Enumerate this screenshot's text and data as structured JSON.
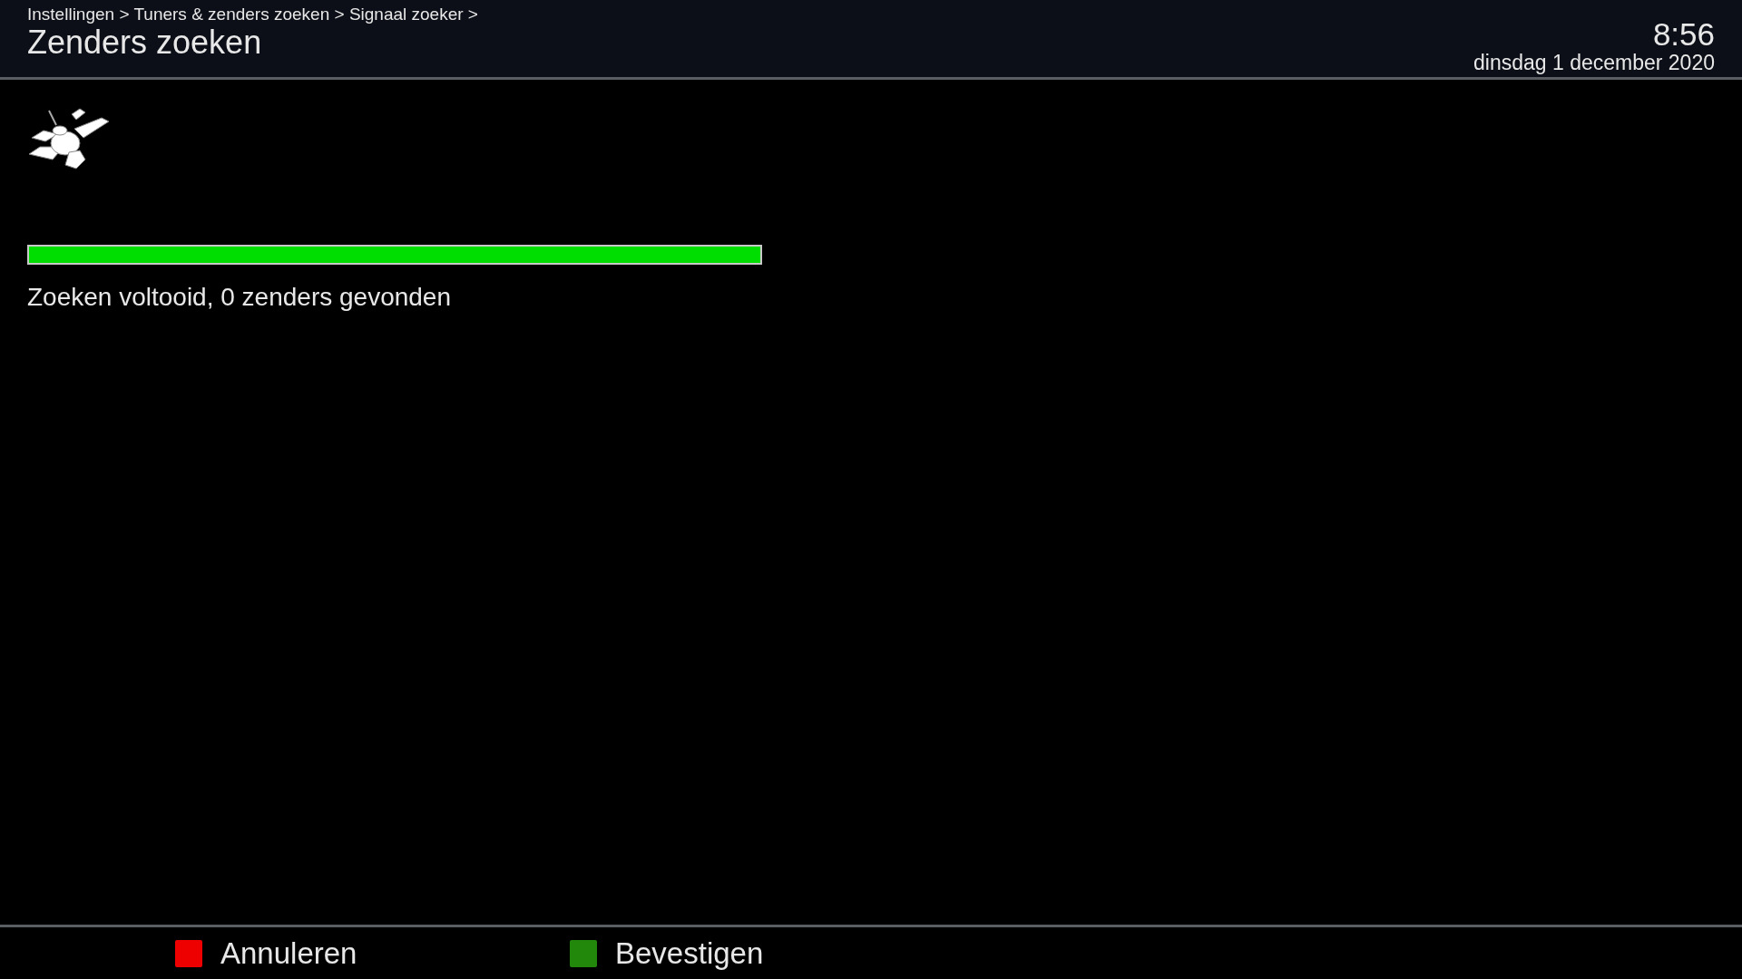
{
  "header": {
    "breadcrumb": "Instellingen > Tuners & zenders zoeken > Signaal zoeker >",
    "title": "Zenders zoeken",
    "time": "8:56",
    "date": "dinsdag 1 december 2020"
  },
  "progress": {
    "level": 1.0,
    "status": "Zoeken voltooid, 0 zenders gevonden"
  },
  "buttons": [
    {
      "label": "Annuleren",
      "color": "#ee0000"
    },
    {
      "label": "Bevestigen",
      "color": "#22880b"
    }
  ]
}
